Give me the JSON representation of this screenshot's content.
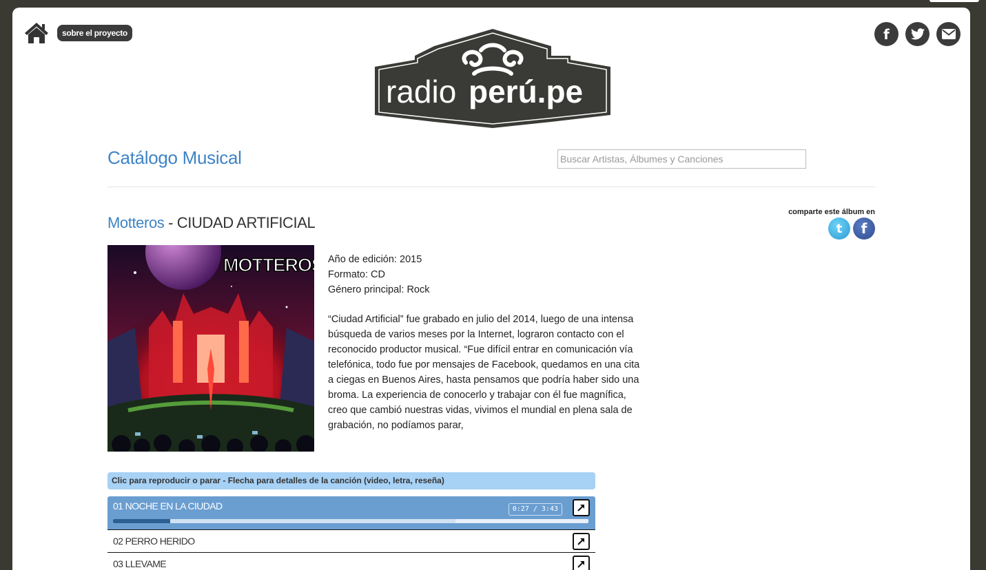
{
  "header": {
    "about_label": "sobre el proyecto",
    "logo_text_regular": "radio",
    "logo_text_bold": "perú.pe",
    "social": [
      {
        "name": "facebook",
        "glyph": "f"
      },
      {
        "name": "twitter",
        "glyph": "t"
      },
      {
        "name": "email",
        "glyph": "✉"
      }
    ]
  },
  "catalog": {
    "title": "Catálogo Musical",
    "search_placeholder": "Buscar Artistas, Álbumes y Canciones"
  },
  "album": {
    "artist": "Motteros",
    "separator": " - ",
    "title": "CIUDAD ARTIFICIAL",
    "cover_text": "MOTTEROS",
    "share_label": "comparte este álbum en",
    "meta": {
      "year_label": "Año de edición:",
      "year": "2015",
      "format_label": "Formato:",
      "format": "CD",
      "genre_label": "Género principal:",
      "genre": "Rock"
    },
    "description": "“Ciudad Artificial” fue grabado en julio del 2014, luego de una intensa búsqueda de varios meses por la Internet, lograron contacto con el reconocido productor musical. “Fue difícil entrar en comunicación vía telefónica, todo fue por mensajes de Facebook, quedamos en una cita a ciegas en Buenos Aires, hasta pensamos que podría haber sido una broma. La experiencia de conocerlo y trabajar con él fue magnífica, creo que cambió nuestras vidas, vivimos el mundial en plena sala de grabación, no podíamos parar,"
  },
  "player": {
    "instructions": "Clic para reproducir o parar - Flecha para detalles de la canción (video, letra, reseña)",
    "time": "0:27 / 3:43",
    "progress_fraction": 0.12,
    "tracks": [
      {
        "title": "01 NOCHE EN LA CIUDAD"
      },
      {
        "title": "02 PERRO HERIDO"
      },
      {
        "title": "03 LLEVAME"
      }
    ]
  },
  "colors": {
    "accent": "#3f84c5",
    "active_track": "#6a9ed1",
    "instructions_bg": "#a7d1f5",
    "frame_bg": "#3a3a32"
  }
}
